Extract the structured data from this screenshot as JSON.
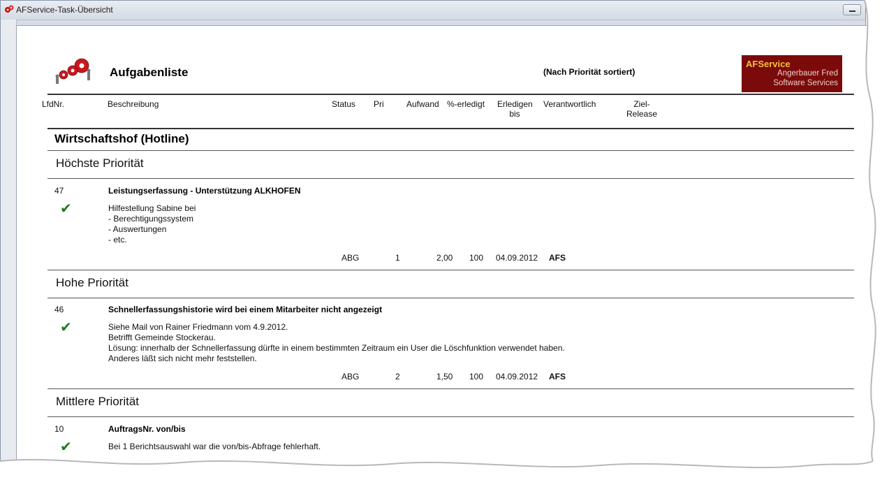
{
  "window": {
    "title": "AFService-Task-Übersicht"
  },
  "report": {
    "title": "Aufgabenliste",
    "sort_note": "(Nach Priorität sortiert)",
    "brand": {
      "name": "AFService",
      "line1": "Angerbauer Fred",
      "line2": "Software Services"
    }
  },
  "columns": {
    "lfdnr": "LfdNr.",
    "beschreibung": "Beschreibung",
    "status": "Status",
    "pri": "Pri",
    "aufwand": "Aufwand",
    "erledigt": "%-erledigt",
    "erledigen_1": "Erledigen",
    "erledigen_2": "bis",
    "verantwortlich": "Verantwortlich",
    "ziel_1": "Ziel-",
    "ziel_2": "Release"
  },
  "group": "Wirtschaftshof (Hotline)",
  "sections": [
    {
      "priority": "Höchste Priorität",
      "task": {
        "nr": "47",
        "title": "Leistungserfassung - Unterstützung ALKHOFEN",
        "desc": [
          "Hilfestellung Sabine bei",
          "- Berechtigungssystem",
          "- Auswertungen",
          "- etc."
        ],
        "status": "ABG",
        "pri": "1",
        "aufwand": "2,00",
        "erledigt": "100",
        "bis": "04.09.2012",
        "verantwortlich": "AFS"
      }
    },
    {
      "priority": "Hohe Priorität",
      "task": {
        "nr": "46",
        "title": "Schnellerfassungshistorie wird bei einem Mitarbeiter nicht angezeigt",
        "desc": [
          "Siehe Mail von Rainer Friedmann vom 4.9.2012.",
          "Betrifft Gemeinde Stockerau.",
          "Lösung: innerhalb der Schnellerfassung dürfte in einem bestimmten Zeitraum ein User die Löschfunktion verwendet haben.",
          "Anderes läßt sich nicht mehr feststellen."
        ],
        "status": "ABG",
        "pri": "2",
        "aufwand": "1,50",
        "erledigt": "100",
        "bis": "04.09.2012",
        "verantwortlich": "AFS"
      }
    },
    {
      "priority": "Mittlere Priorität",
      "task": {
        "nr": "10",
        "title": "AuftragsNr. von/bis",
        "desc": [
          "Bei 1 Berichtsauswahl war die von/bis-Abfrage fehlerhaft."
        ]
      }
    }
  ],
  "icons": {
    "done": "check-icon",
    "app": "gears-icon"
  },
  "colors": {
    "check": "#1d7a1d",
    "brand_bg": "#7b0a0a",
    "brand_name": "#f2c23a"
  }
}
